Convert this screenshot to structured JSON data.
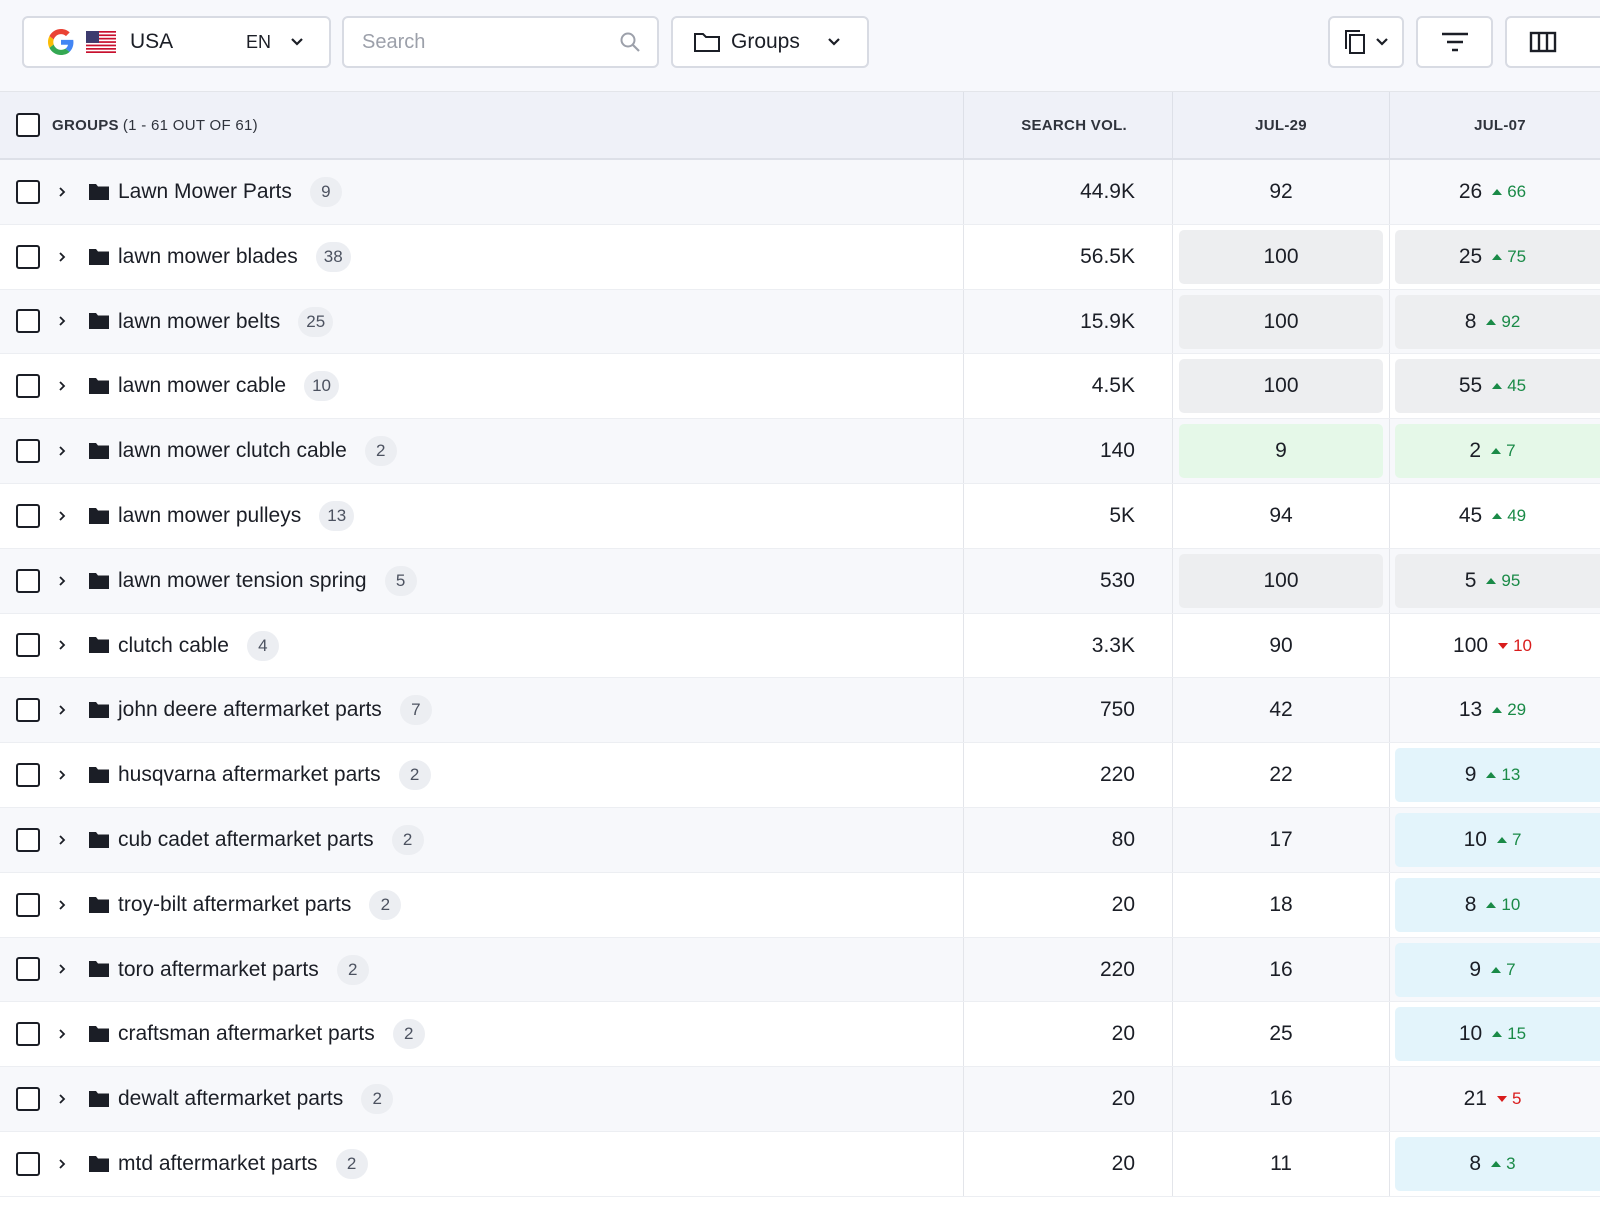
{
  "toolbar": {
    "country": "USA",
    "language": "EN",
    "search_placeholder": "Search",
    "groups_label": "Groups"
  },
  "table": {
    "header": {
      "groups": "GROUPS",
      "groups_range": "(1 - 61 OUT OF 61)",
      "search_vol": "SEARCH VOL.",
      "date1": "JUL-29",
      "date2": "JUL-07"
    },
    "rows": [
      {
        "name": "Lawn Mower Parts",
        "count": "9",
        "volume": "44.9K",
        "d1": "92",
        "d1_bg": "none",
        "d2": "26",
        "delta": "66",
        "dir": "up",
        "d2_bg": "none"
      },
      {
        "name": "lawn mower blades",
        "count": "38",
        "volume": "56.5K",
        "d1": "100",
        "d1_bg": "gray",
        "d2": "25",
        "delta": "75",
        "dir": "up",
        "d2_bg": "gray"
      },
      {
        "name": "lawn mower belts",
        "count": "25",
        "volume": "15.9K",
        "d1": "100",
        "d1_bg": "gray",
        "d2": "8",
        "delta": "92",
        "dir": "up",
        "d2_bg": "gray"
      },
      {
        "name": "lawn mower cable",
        "count": "10",
        "volume": "4.5K",
        "d1": "100",
        "d1_bg": "gray",
        "d2": "55",
        "delta": "45",
        "dir": "up",
        "d2_bg": "gray"
      },
      {
        "name": "lawn mower clutch cable",
        "count": "2",
        "volume": "140",
        "d1": "9",
        "d1_bg": "green",
        "d2": "2",
        "delta": "7",
        "dir": "up",
        "d2_bg": "green"
      },
      {
        "name": "lawn mower pulleys",
        "count": "13",
        "volume": "5K",
        "d1": "94",
        "d1_bg": "none",
        "d2": "45",
        "delta": "49",
        "dir": "up",
        "d2_bg": "none"
      },
      {
        "name": "lawn mower tension spring",
        "count": "5",
        "volume": "530",
        "d1": "100",
        "d1_bg": "gray",
        "d2": "5",
        "delta": "95",
        "dir": "up",
        "d2_bg": "gray"
      },
      {
        "name": "clutch cable",
        "count": "4",
        "volume": "3.3K",
        "d1": "90",
        "d1_bg": "none",
        "d2": "100",
        "delta": "10",
        "dir": "down",
        "d2_bg": "none"
      },
      {
        "name": "john deere aftermarket parts",
        "count": "7",
        "volume": "750",
        "d1": "42",
        "d1_bg": "none",
        "d2": "13",
        "delta": "29",
        "dir": "up",
        "d2_bg": "none"
      },
      {
        "name": "husqvarna aftermarket parts",
        "count": "2",
        "volume": "220",
        "d1": "22",
        "d1_bg": "none",
        "d2": "9",
        "delta": "13",
        "dir": "up",
        "d2_bg": "blue"
      },
      {
        "name": "cub cadet aftermarket parts",
        "count": "2",
        "volume": "80",
        "d1": "17",
        "d1_bg": "none",
        "d2": "10",
        "delta": "7",
        "dir": "up",
        "d2_bg": "blue"
      },
      {
        "name": "troy-bilt aftermarket parts",
        "count": "2",
        "volume": "20",
        "d1": "18",
        "d1_bg": "none",
        "d2": "8",
        "delta": "10",
        "dir": "up",
        "d2_bg": "blue"
      },
      {
        "name": "toro aftermarket parts",
        "count": "2",
        "volume": "220",
        "d1": "16",
        "d1_bg": "none",
        "d2": "9",
        "delta": "7",
        "dir": "up",
        "d2_bg": "blue"
      },
      {
        "name": "craftsman aftermarket parts",
        "count": "2",
        "volume": "20",
        "d1": "25",
        "d1_bg": "none",
        "d2": "10",
        "delta": "15",
        "dir": "up",
        "d2_bg": "blue"
      },
      {
        "name": "dewalt aftermarket parts",
        "count": "2",
        "volume": "20",
        "d1": "16",
        "d1_bg": "none",
        "d2": "21",
        "delta": "5",
        "dir": "down",
        "d2_bg": "none"
      },
      {
        "name": "mtd aftermarket parts",
        "count": "2",
        "volume": "20",
        "d1": "11",
        "d1_bg": "none",
        "d2": "8",
        "delta": "3",
        "dir": "up",
        "d2_bg": "blue"
      }
    ]
  }
}
